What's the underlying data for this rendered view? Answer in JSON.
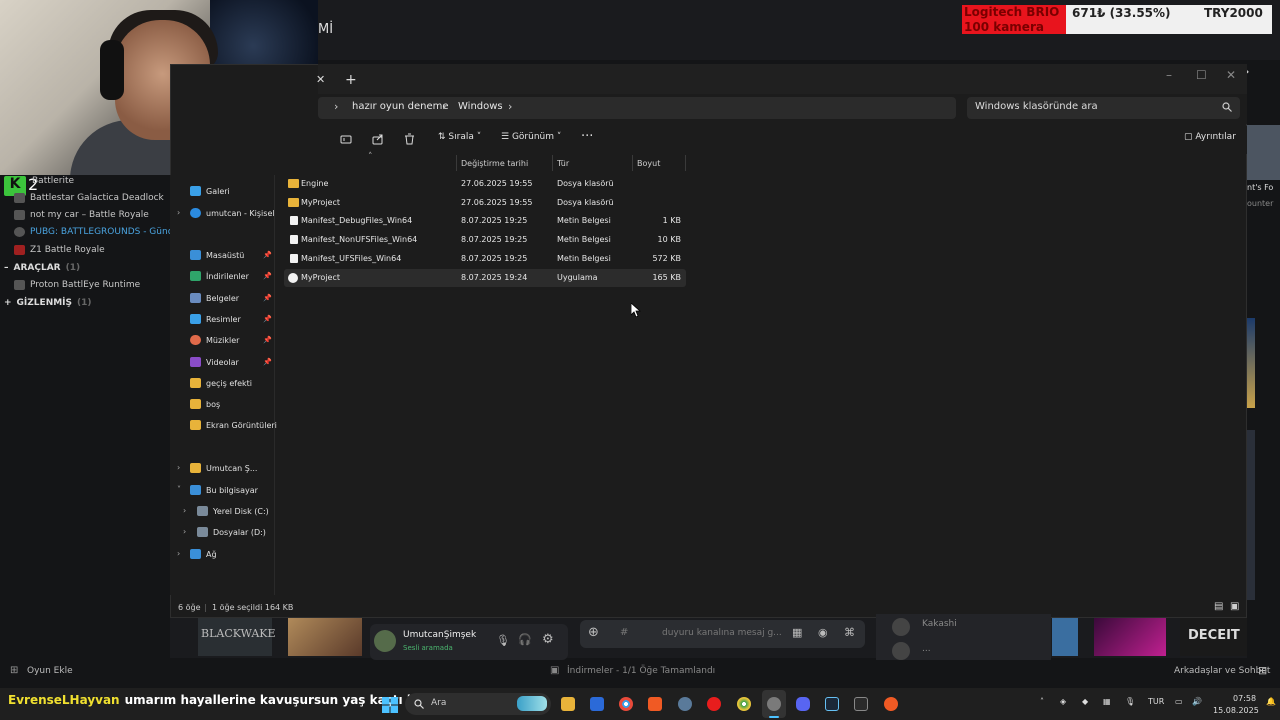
{
  "stream": {
    "top_label": "Mİ",
    "donation": {
      "line1": "Logitech BRIO",
      "line2": "100 kamera",
      "amount": "671₺ (33.55%)",
      "goal": "TRY2000"
    },
    "chat_user": "EvrenseLHayvan",
    "chat_message": "umarım hayallerine kavuşursun yaş kaçtı bu arada",
    "chat_user_color": "#f0e030"
  },
  "launcher": {
    "games": [
      "Battlerite",
      "Battlestar Galactica Deadlock",
      "not my car – Battle Royale",
      "PUBG: BATTLEGROUNDS - Güncel",
      "Z1 Battle Royale"
    ],
    "tools_header": "ARAÇLAR",
    "tools_count": "(1)",
    "tools": [
      "Proton BattlEye Runtime"
    ],
    "hidden_header": "GİZLENMİŞ",
    "hidden_count": "(1)",
    "add_game": "Oyun Ekle",
    "downloads": "İndirmeler - 1/1 Öğe Tamamlandı",
    "friends_chat": "Arkadaşlar ve Sohbet",
    "right_partial_1": "nt's Fo",
    "right_partial_2": "ounter",
    "deceit_logo": "DECEIT",
    "blackwake_logo": "BLACKWAKE"
  },
  "discord": {
    "username": "UmutcanŞimşek",
    "user_status": "Sesli aramada",
    "message_placeholder": "duyuru kanalına mesaj g...",
    "friend_name": "Kakashi",
    "friend_dots": "..."
  },
  "explorer": {
    "breadcrumb": [
      "hazır oyun deneme",
      "Windows"
    ],
    "search_placeholder": "Windows klasöründe ara",
    "toolbar": {
      "sort": "Sırala",
      "view": "Görünüm",
      "more": "···",
      "details": "Ayrıntılar"
    },
    "columns": {
      "modified": "Değiştirme tarihi",
      "type": "Tür",
      "size": "Boyut"
    },
    "nav_items": [
      {
        "label": "Galeri",
        "icon": "gallery-icon"
      },
      {
        "label": "umutcan - Kişisel",
        "icon": "onedrive-icon"
      },
      {
        "label": "Masaüstü",
        "icon": "desktop-icon"
      },
      {
        "label": "İndirilenler",
        "icon": "download-icon"
      },
      {
        "label": "Belgeler",
        "icon": "documents-icon"
      },
      {
        "label": "Resimler",
        "icon": "pictures-icon"
      },
      {
        "label": "Müzikler",
        "icon": "music-icon"
      },
      {
        "label": "Videolar",
        "icon": "videos-icon"
      },
      {
        "label": "geçiş efekti",
        "icon": "folder-icon"
      },
      {
        "label": "boş",
        "icon": "folder-icon"
      },
      {
        "label": "Ekran Görüntüleri",
        "icon": "folder-icon"
      },
      {
        "label": "Umutcan Ş...",
        "icon": "folder-icon"
      },
      {
        "label": "Bu bilgisayar",
        "icon": "computer-icon"
      },
      {
        "label": "Yerel Disk (C:)",
        "icon": "drive-icon"
      },
      {
        "label": "Dosyalar (D:)",
        "icon": "drive-icon"
      },
      {
        "label": "Ağ",
        "icon": "network-icon"
      }
    ],
    "files": [
      {
        "name": "Engine",
        "modified": "27.06.2025 19:55",
        "type": "Dosya klasörü",
        "size": "",
        "kind": "folder"
      },
      {
        "name": "MyProject",
        "modified": "27.06.2025 19:55",
        "type": "Dosya klasörü",
        "size": "",
        "kind": "folder"
      },
      {
        "name": "Manifest_DebugFiles_Win64",
        "modified": "8.07.2025 19:25",
        "type": "Metin Belgesi",
        "size": "1 KB",
        "kind": "doc"
      },
      {
        "name": "Manifest_NonUFSFiles_Win64",
        "modified": "8.07.2025 19:25",
        "type": "Metin Belgesi",
        "size": "10 KB",
        "kind": "doc"
      },
      {
        "name": "Manifest_UFSFiles_Win64",
        "modified": "8.07.2025 19:25",
        "type": "Metin Belgesi",
        "size": "572 KB",
        "kind": "doc"
      },
      {
        "name": "MyProject",
        "modified": "8.07.2025 19:24",
        "type": "Uygulama",
        "size": "165 KB",
        "kind": "app"
      }
    ],
    "status": {
      "count": "6 öğe",
      "selected": "1 öğe seçildi  164 KB"
    }
  },
  "taskbar": {
    "search": "Ara",
    "lang": "TUR",
    "time": "07:58",
    "date": "15.08.2025"
  },
  "colors": {
    "folder": "#e8b33a",
    "accent": "#4cc2ff",
    "donation_red": "#e8141d",
    "pubg_blue": "#4aa3df"
  }
}
